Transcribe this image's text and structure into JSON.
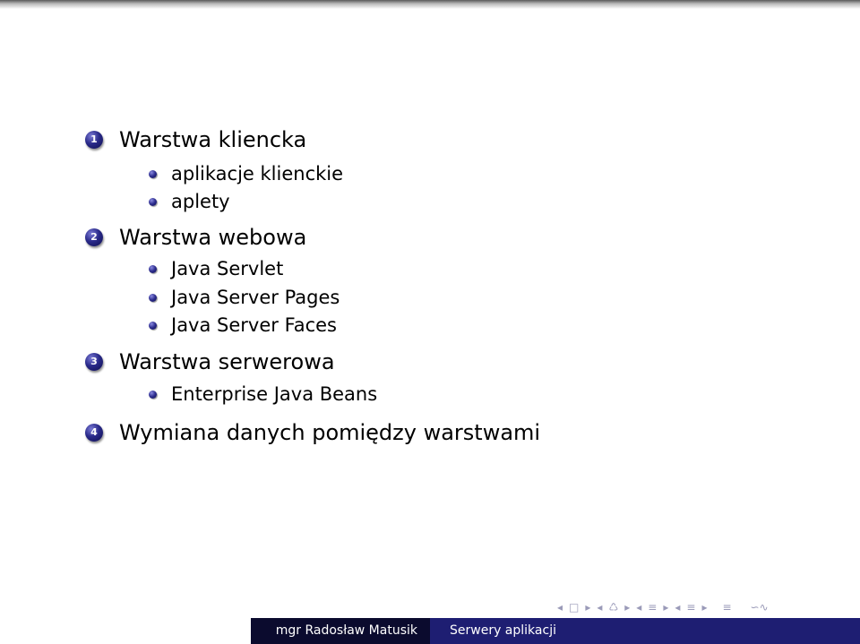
{
  "outline": [
    {
      "number": "1",
      "title": "Warstwa kliencka",
      "items": [
        "aplikacje klienckie",
        "aplety"
      ]
    },
    {
      "number": "2",
      "title": "Warstwa webowa",
      "items": [
        "Java Servlet",
        "Java Server Pages",
        "Java Server Faces"
      ]
    },
    {
      "number": "3",
      "title": "Warstwa serwerowa",
      "items": [
        "Enterprise Java Beans"
      ]
    },
    {
      "number": "4",
      "title": "Wymiana danych pomiędzy warstwami",
      "items": []
    }
  ],
  "nav_symbols": {
    "first": "◂",
    "frame": "□",
    "prev_frame": "▸",
    "section_prev": "◂",
    "section_icon": "♺",
    "section_next": "▸",
    "subsection_prev": "◂",
    "subsection_icon": "≡",
    "subsection_next": "▸",
    "slide_prev": "◂",
    "slide_icon": "≡",
    "slide_next": "▸",
    "toc_icon": "≡",
    "search": "∽∿"
  },
  "footer": {
    "author": "mgr Radosław Matusik",
    "title": "Serwery aplikacji"
  },
  "colors": {
    "ball": "#2a2a8a",
    "footer_dark": "#0b0b2e",
    "footer_blue": "#1e1e72",
    "nav": "#9a9ab8"
  }
}
